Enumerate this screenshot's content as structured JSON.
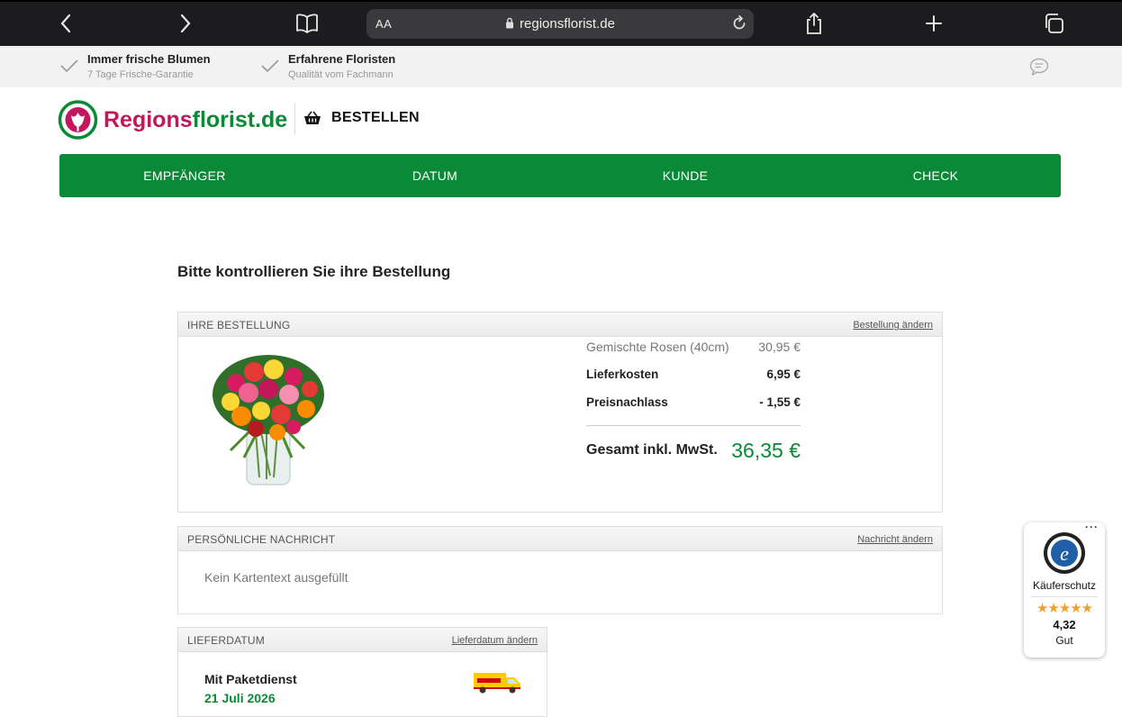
{
  "browser": {
    "text_size_label": "AA",
    "url": "regionsflorist.de"
  },
  "usp": [
    {
      "title": "Immer frische Blumen",
      "subtitle": "7 Tage Frische-Garantie"
    },
    {
      "title": "Erfahrene Floristen",
      "subtitle": "Qualität vom Fachmann"
    }
  ],
  "header": {
    "logo_part1": "Regions",
    "logo_part2": "florist.de",
    "section_label": "BESTELLEN"
  },
  "steps": [
    "EMPFÄNGER",
    "DATUM",
    "KUNDE",
    "CHECK"
  ],
  "page_title": "Bitte kontrollieren Sie ihre Bestellung",
  "order": {
    "title": "IHRE BESTELLUNG",
    "edit_link": "Bestellung ändern",
    "items": [
      {
        "label": "Gemischte Rosen (40cm)",
        "value": "30,95 €"
      },
      {
        "label": "Lieferkosten",
        "value": "6,95 €"
      },
      {
        "label": "Preisnachlass",
        "value": "- 1,55 €"
      }
    ],
    "total_label": "Gesamt inkl. MwSt.",
    "total_value": "36,35 €"
  },
  "message": {
    "title": "PERSÖNLICHE NACHRICHT",
    "edit_link": "Nachricht ändern",
    "text": "Kein Kartentext ausgefüllt"
  },
  "delivery": {
    "title": "LIEFERDATUM",
    "edit_link": "Lieferdatum ändern",
    "method": "Mit Paketdienst",
    "date": "21 Juli 2026"
  },
  "trust_badge": {
    "label": "Käuferschutz",
    "stars": "★★★★★",
    "rating": "4,32",
    "grade": "Gut",
    "star_color": "#f0a030"
  },
  "colors": {
    "brand_green": "#0a8a37",
    "brand_pink": "#c2185b"
  }
}
